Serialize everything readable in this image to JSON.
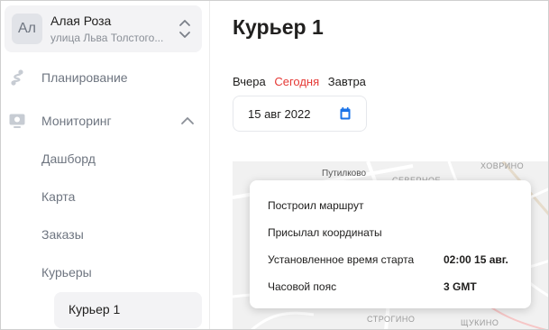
{
  "sidebar": {
    "org": {
      "avatar_initials": "Ал",
      "name": "Алая Роза",
      "address": "улица Льва Толстого..."
    },
    "nav": {
      "planning": {
        "label": "Планирование",
        "icon": "route-icon"
      },
      "monitoring": {
        "label": "Мониторинг",
        "icon": "monitor-icon",
        "expanded": true
      },
      "sub_items": [
        "Дашборд",
        "Карта",
        "Заказы",
        "Курьеры"
      ],
      "active_item": "Курьер 1"
    }
  },
  "main": {
    "title": "Курьер 1",
    "day_links": {
      "yesterday": "Вчера",
      "today": "Сегодня",
      "tomorrow": "Завтра"
    },
    "date_value": "15 авг 2022",
    "map": {
      "labels": [
        "Путилково",
        "СЕВЕРНОЕ",
        "ХОВРИНО",
        "СТРОГИНО",
        "ЩУКИНО"
      ]
    },
    "info": {
      "route_built": "Построил маршрут",
      "sent_coordinates": "Присылал координаты",
      "start_time_label": "Установленное время старта",
      "start_time_value": "02:00 15 авг.",
      "timezone_label": "Часовой пояс",
      "timezone_value": "3 GMT"
    }
  },
  "colors": {
    "accent_red": "#e53935",
    "accent_blue": "#1a73e8",
    "sidebar_active_bg": "#f3f3f5"
  }
}
